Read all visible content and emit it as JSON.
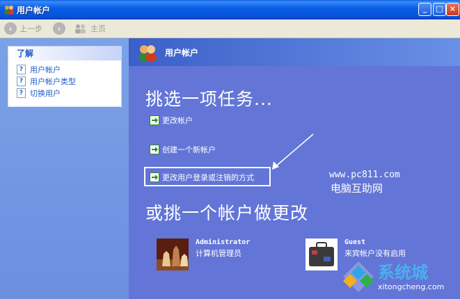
{
  "window": {
    "title": "用户帐户"
  },
  "toolbar": {
    "back": "上一步",
    "home": "主页"
  },
  "sidebar": {
    "header": "了解",
    "items": [
      {
        "label": "用户帐户"
      },
      {
        "label": "用户帐户类型"
      },
      {
        "label": "切换用户"
      }
    ]
  },
  "main": {
    "banner_title": "用户帐户",
    "heading_tasks": "挑选一项任务...",
    "tasks": [
      {
        "label": "更改帐户"
      },
      {
        "label": "创建一个新帐户"
      },
      {
        "label": "更改用户登录或注销的方式"
      }
    ],
    "heading_accounts": "或挑一个帐户做更改",
    "accounts": [
      {
        "name": "Administrator",
        "desc": "计算机管理员"
      },
      {
        "name": "Guest",
        "desc": "来宾帐户没有启用"
      }
    ]
  },
  "watermark": {
    "url": "www.pc811.com",
    "label": "电脑互助网"
  },
  "brand": {
    "cn": "系统城",
    "url": "xitongcheng.com"
  },
  "colors": {
    "titlebar": "#0a5fe9",
    "main_bg": "#6375d6",
    "task_arrow": "#2f8a2f"
  }
}
